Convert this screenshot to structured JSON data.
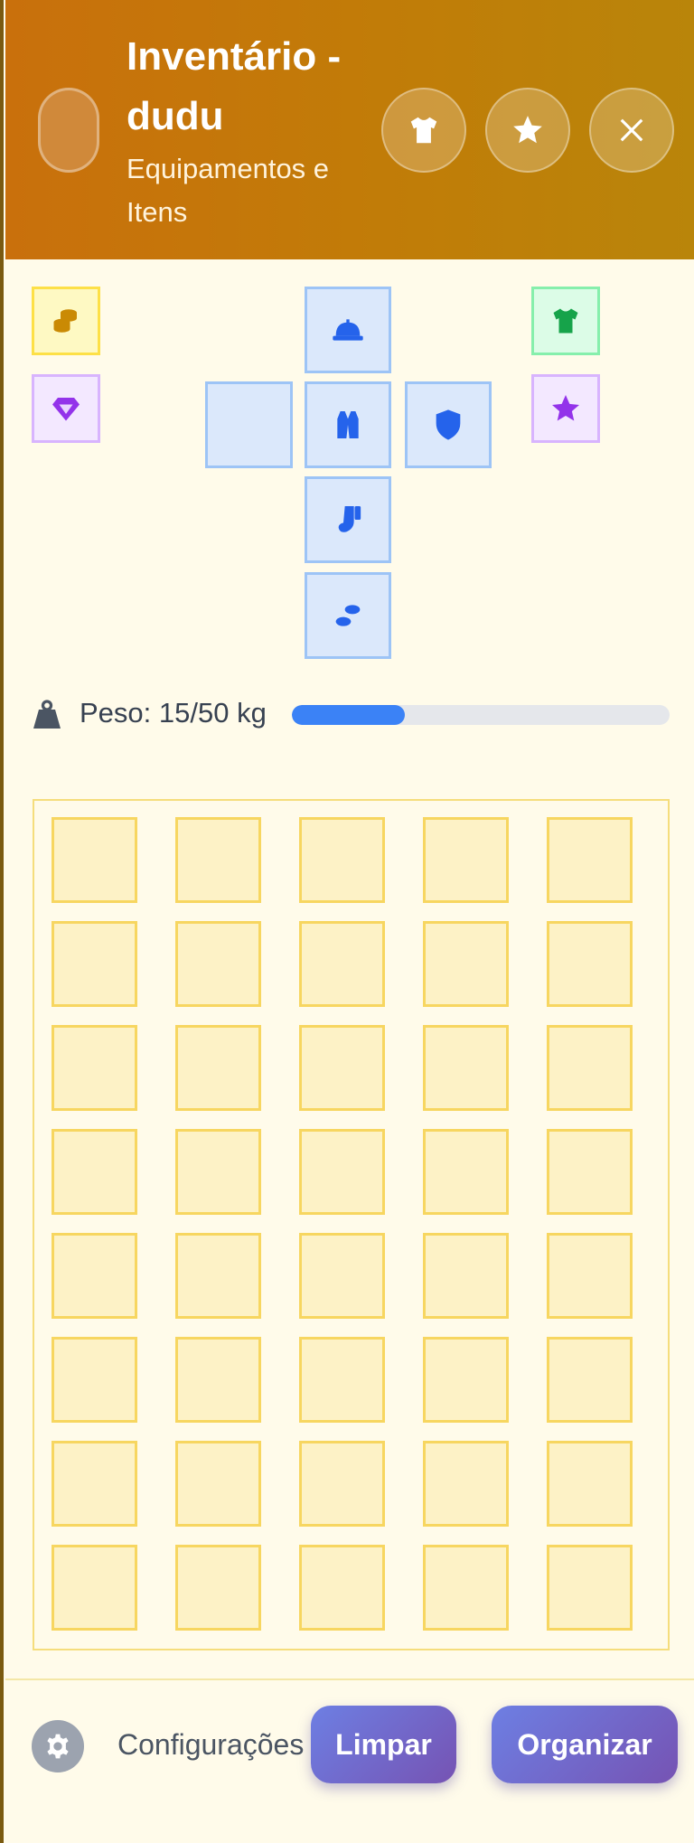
{
  "header": {
    "title": "Inventário - dudu",
    "subtitle": "Equipamentos e Itens",
    "buttons": [
      {
        "icon": "shirt-icon"
      },
      {
        "icon": "star-icon"
      },
      {
        "icon": "close-icon"
      }
    ]
  },
  "equipment": {
    "slots": [
      {
        "slot": "head",
        "icon": "helmet-icon"
      },
      {
        "slot": "left-hand",
        "icon": ""
      },
      {
        "slot": "body",
        "icon": "vest-icon"
      },
      {
        "slot": "right-hand",
        "icon": "shield-icon"
      },
      {
        "slot": "legs",
        "icon": "socks-icon"
      },
      {
        "slot": "feet",
        "icon": "footprints-icon"
      }
    ],
    "side_slots": [
      {
        "icon": "coins-icon",
        "color": "#ca8a04"
      },
      {
        "icon": "gem-icon",
        "color": "#9333ea"
      },
      {
        "icon": "shirt-icon",
        "color": "#16a34a"
      },
      {
        "icon": "star-icon",
        "color": "#9333ea"
      }
    ]
  },
  "weight": {
    "label": "Peso: 15/50 kg",
    "current": 15,
    "max": 50,
    "fill_fraction": 0.3
  },
  "inventory": {
    "columns": 5,
    "rows": 8
  },
  "footer": {
    "settings_label": "Configurações",
    "clear_label": "Limpar",
    "organize_label": "Organizar"
  },
  "colors": {
    "header_start": "#c9700c",
    "header_end": "#b9850a",
    "equip_slot_border": "#9dc4f6",
    "equip_slot_bg": "#dbe8fb",
    "inventory_cell_border": "#f7d660",
    "inventory_cell_bg": "#fdf2c6",
    "weight_bar": "#3b82f6",
    "primary_button": "#6d7fe3"
  }
}
